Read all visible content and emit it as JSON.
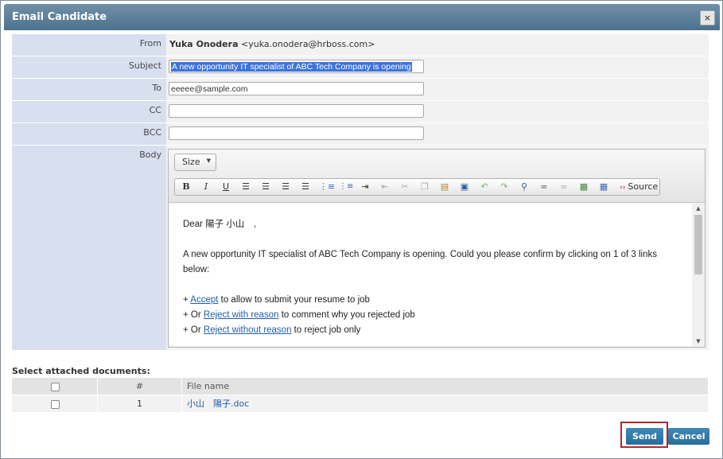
{
  "dialog": {
    "title": "Email Candidate",
    "close_glyph": "×"
  },
  "form": {
    "from_label": "From",
    "from_name": "Yuka Onodera",
    "from_email": "<yuka.onodera@hrboss.com>",
    "subject_label": "Subject",
    "subject_value": "A new opportunity IT specialist of ABC Tech Company is opening",
    "to_label": "To",
    "to_value": "eeeee@sample.com",
    "cc_label": "CC",
    "cc_value": "",
    "bcc_label": "BCC",
    "bcc_value": "",
    "body_label": "Body"
  },
  "editor": {
    "size_label": "Size",
    "source_label": "Source",
    "toolbar_icons": [
      "bold-icon",
      "italic-icon",
      "underline-icon",
      "align-left-icon",
      "align-center-icon",
      "align-right-icon",
      "align-justify-icon",
      "bulleted-list-icon",
      "numbered-list-icon",
      "indent-icon",
      "outdent-icon",
      "cut-icon",
      "copy-icon",
      "paste-icon",
      "paste-from-word-icon",
      "undo-icon",
      "redo-icon",
      "find-icon",
      "link-icon",
      "unlink-icon",
      "image-icon",
      "table-icon",
      "source-icon"
    ],
    "greeting": "Dear 陽子 小山　,",
    "intro_line1": "A new opportunity IT specialist of ABC Tech Company is opening. Could you please confirm by clicking on 1 of 3 links",
    "intro_line2": "below:",
    "opt1_prefix": "+ ",
    "opt1_link": "Accept",
    "opt1_suffix": " to allow to submit your resume to job",
    "opt2_prefix": "+ Or ",
    "opt2_link": "Reject with reason",
    "opt2_suffix": " to comment why you rejected job",
    "opt3_prefix": "+ Or ",
    "opt3_link": "Reject without reason",
    "opt3_suffix": " to reject job only"
  },
  "documents": {
    "title": "Select attached documents:",
    "columns": {
      "number": "#",
      "file_name": "File name"
    },
    "rows": [
      {
        "number": "1",
        "file_name": "小山　陽子.doc",
        "checked": false
      }
    ]
  },
  "actions": {
    "send_label": "Send",
    "cancel_label": "Cancel"
  },
  "colors": {
    "title_bar": "#5a7d99",
    "label_bg": "#d8e0ef",
    "button": "#2f7aa8",
    "highlight": "#b0272b",
    "link": "#1f5fa8"
  }
}
